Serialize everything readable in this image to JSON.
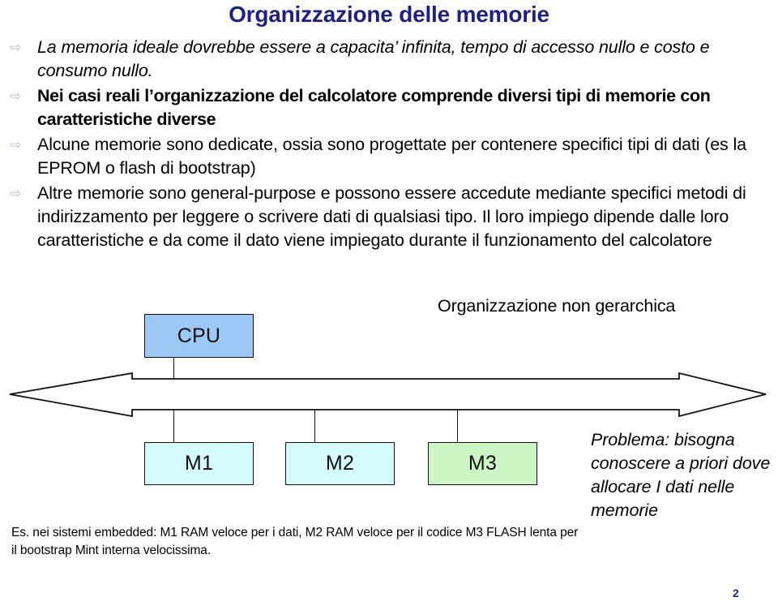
{
  "slide": {
    "title": "Organizzazione delle memorie",
    "page_number": "2",
    "title_color": "#1f1f8c",
    "bullet_glyph": "⇨"
  },
  "bullets": [
    {
      "marker": "⇨",
      "text": "La memoria ideale dovrebbe essere a capacita’ infinita, tempo di accesso nullo e costo e consumo nullo.",
      "style": "italic"
    },
    {
      "marker": "⇨",
      "text": "Nei casi reali l’organizzazione del calcolatore comprende diversi tipi di memorie con caratteristiche diverse",
      "style": "semibold"
    },
    {
      "marker": "⇨",
      "text": "Alcune memorie sono dedicate, ossia sono progettate per contenere specifici tipi di dati (es la EPROM o flash di bootstrap)",
      "style": "regular"
    },
    {
      "marker": "⇨",
      "text": "Altre memorie sono general-purpose e possono essere accedute mediante specifici metodi di indirizzamento per leggere o scrivere dati di qualsiasi tipo. Il loro impiego dipende dalle loro caratteristiche e da come il dato viene impiegato durante il funzionamento del calcolatore",
      "style": "regular"
    }
  ],
  "diagram": {
    "org_label": "Organizzazione non gerarchica",
    "cpu": {
      "label": "CPU",
      "color": "#9cc8f5"
    },
    "memories": [
      {
        "label": "M1",
        "color": "#d4fcfd"
      },
      {
        "label": "M2",
        "color": "#d4fcfd"
      },
      {
        "label": "M3",
        "color": "#ccf5c4"
      }
    ],
    "bus": {
      "name": "bidirectional-bus",
      "color": "#111111"
    },
    "problem_note": "Problema: bisogna conoscere a priori dove allocare I dati nelle memorie",
    "example_note": "Es. nei sistemi embedded: M1 RAM veloce per i dati, M2 RAM veloce per il codice M3 FLASH lenta per il bootstrap Mint interna velocissima."
  }
}
